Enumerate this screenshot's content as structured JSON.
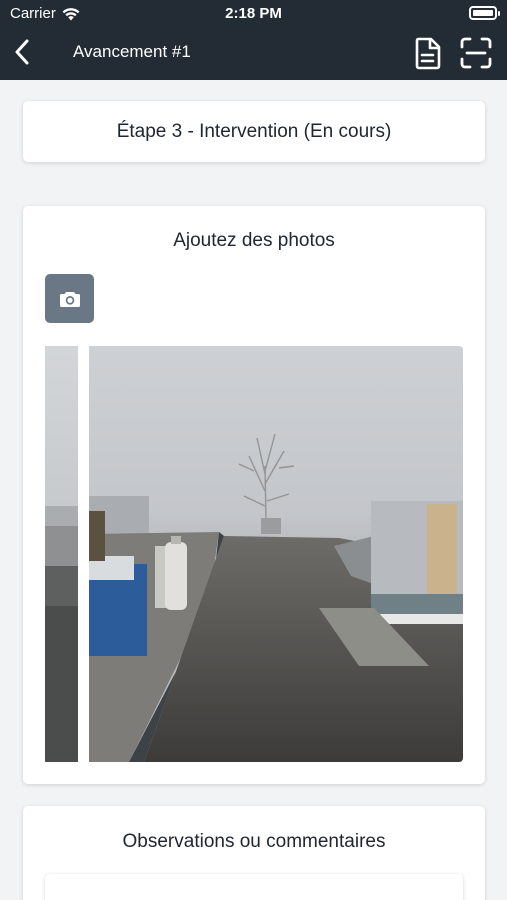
{
  "status_bar": {
    "carrier": "Carrier",
    "time": "2:18 PM"
  },
  "nav": {
    "title": "Avancement #1",
    "back_icon": "chevron-left-icon",
    "doc_icon": "document-icon",
    "scan_icon": "scan-icon"
  },
  "step": {
    "label": "Étape 3 - Intervention (En cours)"
  },
  "photos": {
    "title": "Ajoutez des photos",
    "camera_icon": "camera-icon"
  },
  "observations": {
    "title": "Observations ou commentaires",
    "value": ""
  },
  "colors": {
    "header": "#232b35",
    "background": "#f2f3f5",
    "camera_button": "#6a7785"
  }
}
